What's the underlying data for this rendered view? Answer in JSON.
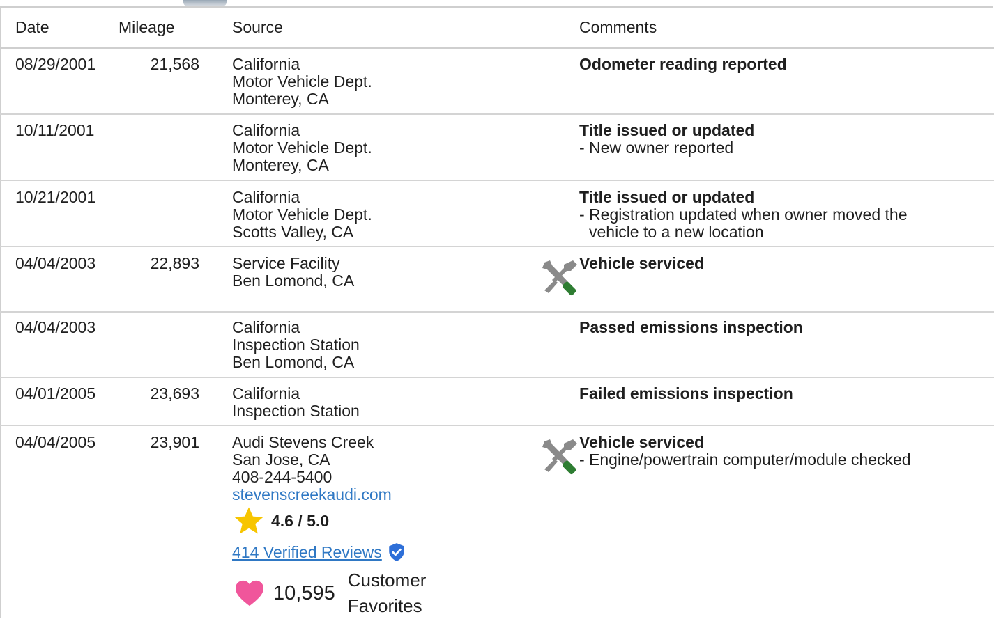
{
  "header": {
    "date": "Date",
    "mileage": "Mileage",
    "source": "Source",
    "comments": "Comments"
  },
  "rows": [
    {
      "date": "08/29/2001",
      "mileage": "21,568",
      "source": [
        "California",
        "Motor Vehicle Dept.",
        "Monterey, CA"
      ],
      "title": "Odometer reading reported",
      "details": []
    },
    {
      "date": "10/11/2001",
      "mileage": "",
      "source": [
        "California",
        "Motor Vehicle Dept.",
        "Monterey, CA"
      ],
      "title": "Title issued or updated",
      "details": [
        "- New owner reported"
      ]
    },
    {
      "date": "10/21/2001",
      "mileage": "",
      "source": [
        "California",
        "Motor Vehicle Dept.",
        "Scotts Valley, CA"
      ],
      "title": "Title issued or updated",
      "details": [
        "- Registration updated when owner moved the",
        "vehicle to a new location"
      ]
    },
    {
      "date": "04/04/2003",
      "mileage": "22,893",
      "source": [
        "Service Facility",
        "Ben Lomond, CA"
      ],
      "title": "Vehicle serviced",
      "details": [],
      "icon": "wrench-screwdriver-icon"
    },
    {
      "date": "04/04/2003",
      "mileage": "",
      "source": [
        "California",
        "Inspection Station",
        "Ben Lomond, CA"
      ],
      "title": "Passed emissions inspection",
      "details": []
    },
    {
      "date": "04/01/2005",
      "mileage": "23,693",
      "source": [
        "California",
        "Inspection Station"
      ],
      "title": "Failed emissions inspection",
      "details": []
    },
    {
      "date": "04/04/2005",
      "mileage": "23,901",
      "source": [
        "Audi Stevens Creek",
        "San Jose, CA",
        "408-244-5400"
      ],
      "source_link": "stevenscreekaudi.com",
      "title": "Vehicle serviced",
      "details": [
        "- Engine/powertrain computer/module checked"
      ],
      "icon": "wrench-screwdriver-icon"
    }
  ],
  "dealer": {
    "rating": "4.6 / 5.0",
    "rating_fraction": 0.92,
    "reviews_link": "414 Verified Reviews",
    "favorites_count": "10,595",
    "favorites_label_1": "Customer",
    "favorites_label_2": "Favorites"
  },
  "colors": {
    "link": "#2f78c4",
    "star": "#f7c500",
    "heart": "#f0569b",
    "badge": "#2e6fd8",
    "wrench": "#8a8a8a",
    "screwdriver": "#2e7d32",
    "border": "#cfcfcf"
  }
}
